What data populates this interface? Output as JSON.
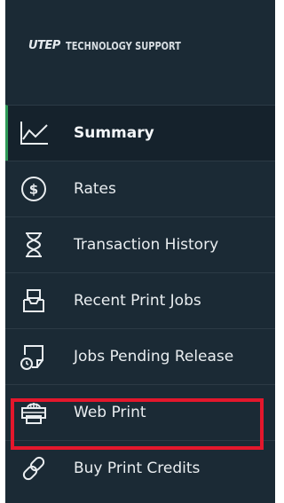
{
  "brand": {
    "logo": "UTEP",
    "title": "TECHNOLOGY SUPPORT"
  },
  "nav": {
    "items": [
      {
        "label": "Summary",
        "icon": "chart-line-icon",
        "active": true
      },
      {
        "label": "Rates",
        "icon": "dollar-circle-icon"
      },
      {
        "label": "Transaction History",
        "icon": "hourglass-icon"
      },
      {
        "label": "Recent Print Jobs",
        "icon": "printer-tray-icon"
      },
      {
        "label": "Jobs Pending Release",
        "icon": "pending-document-icon"
      },
      {
        "label": "Web Print",
        "icon": "web-printer-icon",
        "highlighted": true
      },
      {
        "label": "Buy Print Credits",
        "icon": "link-icon"
      }
    ]
  },
  "colors": {
    "sidebar_bg": "#1b2a35",
    "active_bg": "#15222c",
    "active_accent": "#2e9a57",
    "highlight": "#e4172c",
    "text": "#e9edf0"
  }
}
